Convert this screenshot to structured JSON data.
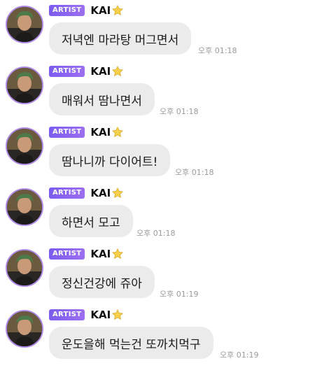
{
  "messages": [
    {
      "badge": "ARTIST",
      "name": "KAI",
      "text": "저녁엔 마라탕 머그면서",
      "time": "오후 01:18"
    },
    {
      "badge": "ARTIST",
      "name": "KAI",
      "text": "매워서 땀나면서",
      "time": "오후 01:18"
    },
    {
      "badge": "ARTIST",
      "name": "KAI",
      "text": "땀나니까 다이어트!",
      "time": "오후 01:18"
    },
    {
      "badge": "ARTIST",
      "name": "KAI",
      "text": "하면서 모고",
      "time": "오후 01:18"
    },
    {
      "badge": "ARTIST",
      "name": "KAI",
      "text": "정신건강에 쥬아",
      "time": "오후 01:19"
    },
    {
      "badge": "ARTIST",
      "name": "KAI",
      "text": "운도을해 먹는건 또까치먹구",
      "time": "오후 01:19"
    }
  ],
  "icons": {
    "name_suffix": "star-icon",
    "avatar": "avatar-photo"
  },
  "colors": {
    "badge": "#8a63f0",
    "avatar_ring": "#b08be6",
    "bubble": "#ebebeb",
    "timestamp": "#9a9a9a"
  }
}
